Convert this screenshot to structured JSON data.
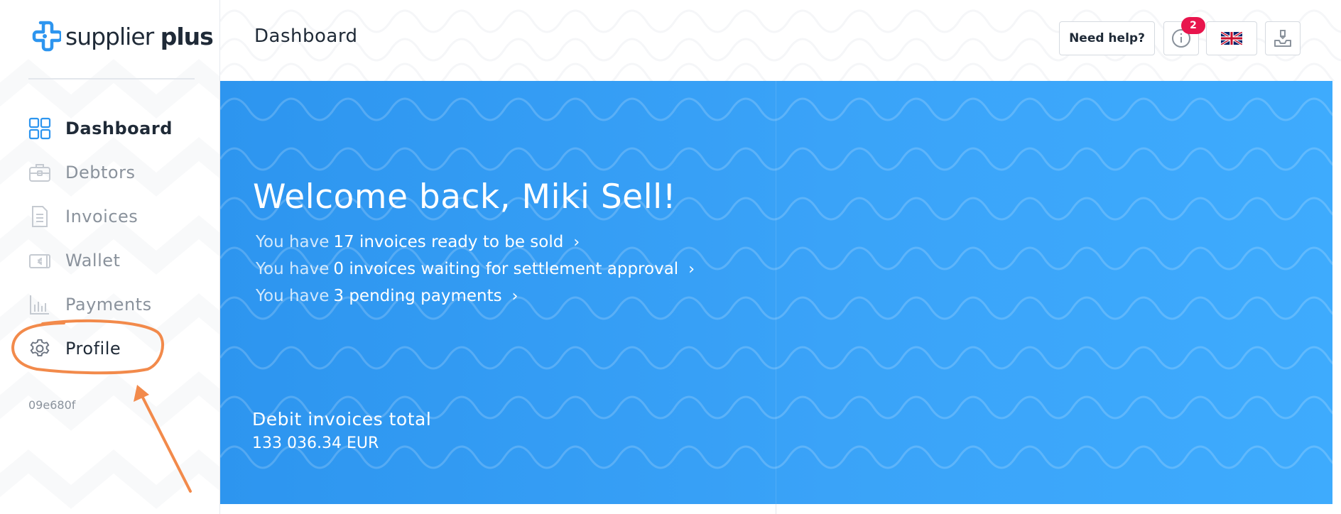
{
  "brand": {
    "name_regular": "supplier",
    "name_bold": "plus",
    "logo_color": "#2d95ef"
  },
  "sidebar": {
    "items": [
      {
        "label": "Dashboard",
        "icon": "dashboard-grid-icon",
        "active": true
      },
      {
        "label": "Debtors",
        "icon": "briefcase-icon"
      },
      {
        "label": "Invoices",
        "icon": "document-icon"
      },
      {
        "label": "Wallet",
        "icon": "wallet-euro-icon"
      },
      {
        "label": "Payments",
        "icon": "bar-chart-icon"
      },
      {
        "label": "Profile",
        "icon": "gear-icon"
      }
    ],
    "version": "09e680f"
  },
  "header": {
    "title": "Dashboard",
    "help_label": "Need help?",
    "notification_count": "2",
    "language_icon": "uk-flag-icon",
    "download_icon": "download-tray-icon"
  },
  "hero": {
    "welcome": "Welcome back, Miki Sell!",
    "lines": [
      {
        "prefix": "You have",
        "highlight": "17 invoices ready to be sold"
      },
      {
        "prefix": "You have",
        "highlight": "0 invoices waiting for settlement approval"
      },
      {
        "prefix": "You have",
        "highlight": "3 pending payments"
      }
    ],
    "total_label": "Debit invoices total",
    "total_value": "133 036.34 EUR"
  },
  "colors": {
    "accent": "#2d95ef",
    "badge": "#e8154d",
    "annotation": "#f28a4b"
  }
}
